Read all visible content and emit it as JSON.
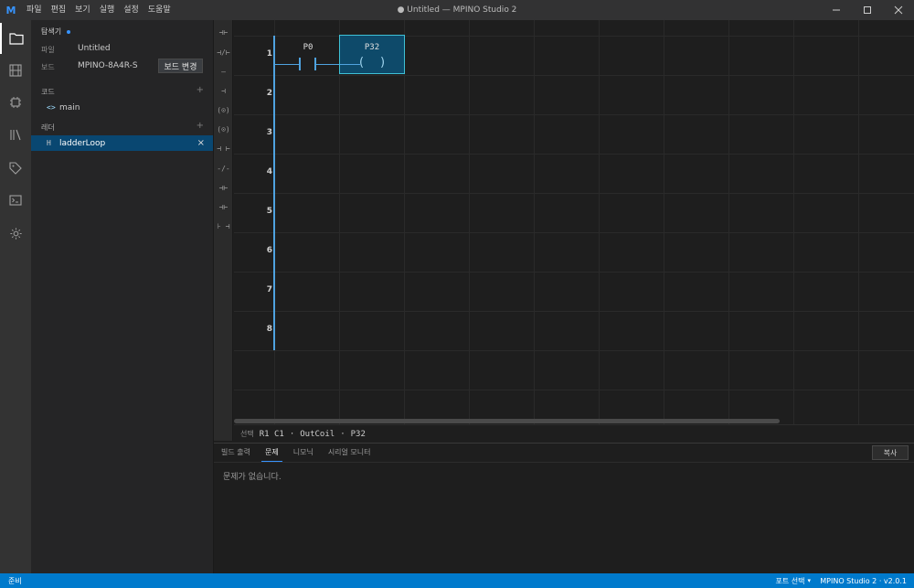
{
  "app": {
    "window_title": "● Untitled — MPINO Studio 2",
    "logo_letter": "M",
    "logo_color": "#3794ff",
    "accent_color": "#007acc"
  },
  "menu": [
    "파일",
    "편집",
    "보기",
    "실행",
    "설정",
    "도움말"
  ],
  "window_controls": [
    "minimize-icon",
    "maximize-icon",
    "close-icon"
  ],
  "activity_bar": [
    "folder-icon",
    "film-icon",
    "chip-icon",
    "library-icon",
    "tag-icon",
    "terminal-icon",
    "gear-icon"
  ],
  "sidebar": {
    "title": "탐색기",
    "file_label": "파일",
    "file_value": "Untitled",
    "board_label": "보드",
    "board_value": "MPINO-8A4R-S",
    "board_button": "보드 변경",
    "code_section": "코드",
    "code_add": "+",
    "code_items": [
      {
        "icon": "<>",
        "label": "main"
      }
    ],
    "ladder_section": "레더",
    "ladder_add": "+",
    "ladder_items": [
      {
        "icon": "H",
        "label": "ladderLoop",
        "close": "×"
      }
    ]
  },
  "toolbox": [
    "⊣⊢",
    "⊣/⊢",
    "—",
    "⊣",
    "(⊙)",
    "(⊙)",
    "⊣ ⊢",
    "-/-",
    "⊣⊢",
    "⊣⊢",
    "⊦ ⊣"
  ],
  "ladder": {
    "rungs": [
      "1",
      "2",
      "3",
      "4",
      "5",
      "6",
      "7",
      "8"
    ],
    "contact_label": "P0",
    "coil_label": "P32",
    "coil_left_paren": "(",
    "coil_right_paren": ")"
  },
  "selection": {
    "label": "선택",
    "position": "R1 C1",
    "sep1": "·",
    "type": "OutCoil",
    "sep2": "·",
    "target": "P32"
  },
  "panel": {
    "tabs": [
      "빌드 출력",
      "문제",
      "니모닉",
      "시리얼 모니터"
    ],
    "active_tab": "문제",
    "copy_button": "복사",
    "message": "문제가 없습니다."
  },
  "statusbar": {
    "left": "준비",
    "port": "포트 선택",
    "port_caret": "▾",
    "version": "MPINO Studio 2 · v2.0.1"
  }
}
